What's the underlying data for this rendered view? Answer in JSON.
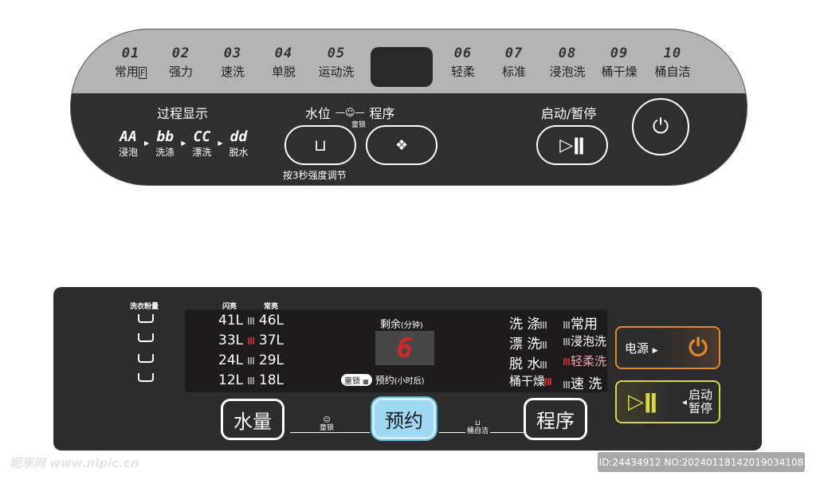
{
  "top_panel": {
    "programs": [
      {
        "num": "01",
        "label": "常用",
        "badge": "F"
      },
      {
        "num": "02",
        "label": "强力"
      },
      {
        "num": "03",
        "label": "速洗"
      },
      {
        "num": "04",
        "label": "单脱"
      },
      {
        "num": "05",
        "label": "运动洗"
      },
      {
        "num": "06",
        "label": "轻柔"
      },
      {
        "num": "07",
        "label": "标准"
      },
      {
        "num": "08",
        "label": "浸泡洗"
      },
      {
        "num": "09",
        "label": "桶干燥"
      },
      {
        "num": "10",
        "label": "桶自洁"
      }
    ],
    "process_title": "过程显示",
    "process": [
      {
        "code": "AA",
        "label": "浸泡"
      },
      {
        "code": "bb",
        "label": "洗涤"
      },
      {
        "code": "CC",
        "label": "漂洗"
      },
      {
        "code": "dd",
        "label": "脱水"
      }
    ],
    "water_label": "水位",
    "program_label": "程序",
    "child_lock": "童锁",
    "hold_hint": "按3秒强度调节",
    "start_pause": "启动/暂停"
  },
  "bottom_panel": {
    "detergent": "洗衣粉量",
    "flash": "闪亮",
    "steady": "常亮",
    "levels": [
      {
        "a": "41L",
        "b": "46L",
        "active": false
      },
      {
        "a": "33L",
        "b": "37L",
        "active": true
      },
      {
        "a": "24L",
        "b": "29L",
        "active": false
      },
      {
        "a": "12L",
        "b": "18L",
        "active": false
      }
    ],
    "remain": "剩余",
    "remain_unit": "(分钟)",
    "digit": "6",
    "child_lock": "童锁",
    "reserve": "预约",
    "reserve_unit": "(小时后)",
    "stages": [
      {
        "label": "洗 涤",
        "active": false
      },
      {
        "label": "漂 洗",
        "active": false
      },
      {
        "label": "脱 水",
        "active": false
      },
      {
        "label": "桶干燥",
        "active": true
      }
    ],
    "modes": [
      {
        "label": "常用",
        "active": false
      },
      {
        "label": "浸泡洗",
        "active": false
      },
      {
        "label": "轻柔洗",
        "active": true
      },
      {
        "label": "速 洗",
        "active": false
      }
    ],
    "btn_water": "水量",
    "btn_reserve": "预约",
    "btn_program": "程序",
    "tub_clean": "桶自洁",
    "power": "电源",
    "start": "启动",
    "pause": "暂停",
    "colors": {
      "power": "#e8862a",
      "start": "#d9d64a",
      "reserve_btn": "#9fd8f3",
      "led_red": "#c0282d"
    }
  },
  "watermark": {
    "logo": "昵享网 www.nipic.cn",
    "id": "ID:24434912 NO:20240118142019034108"
  }
}
